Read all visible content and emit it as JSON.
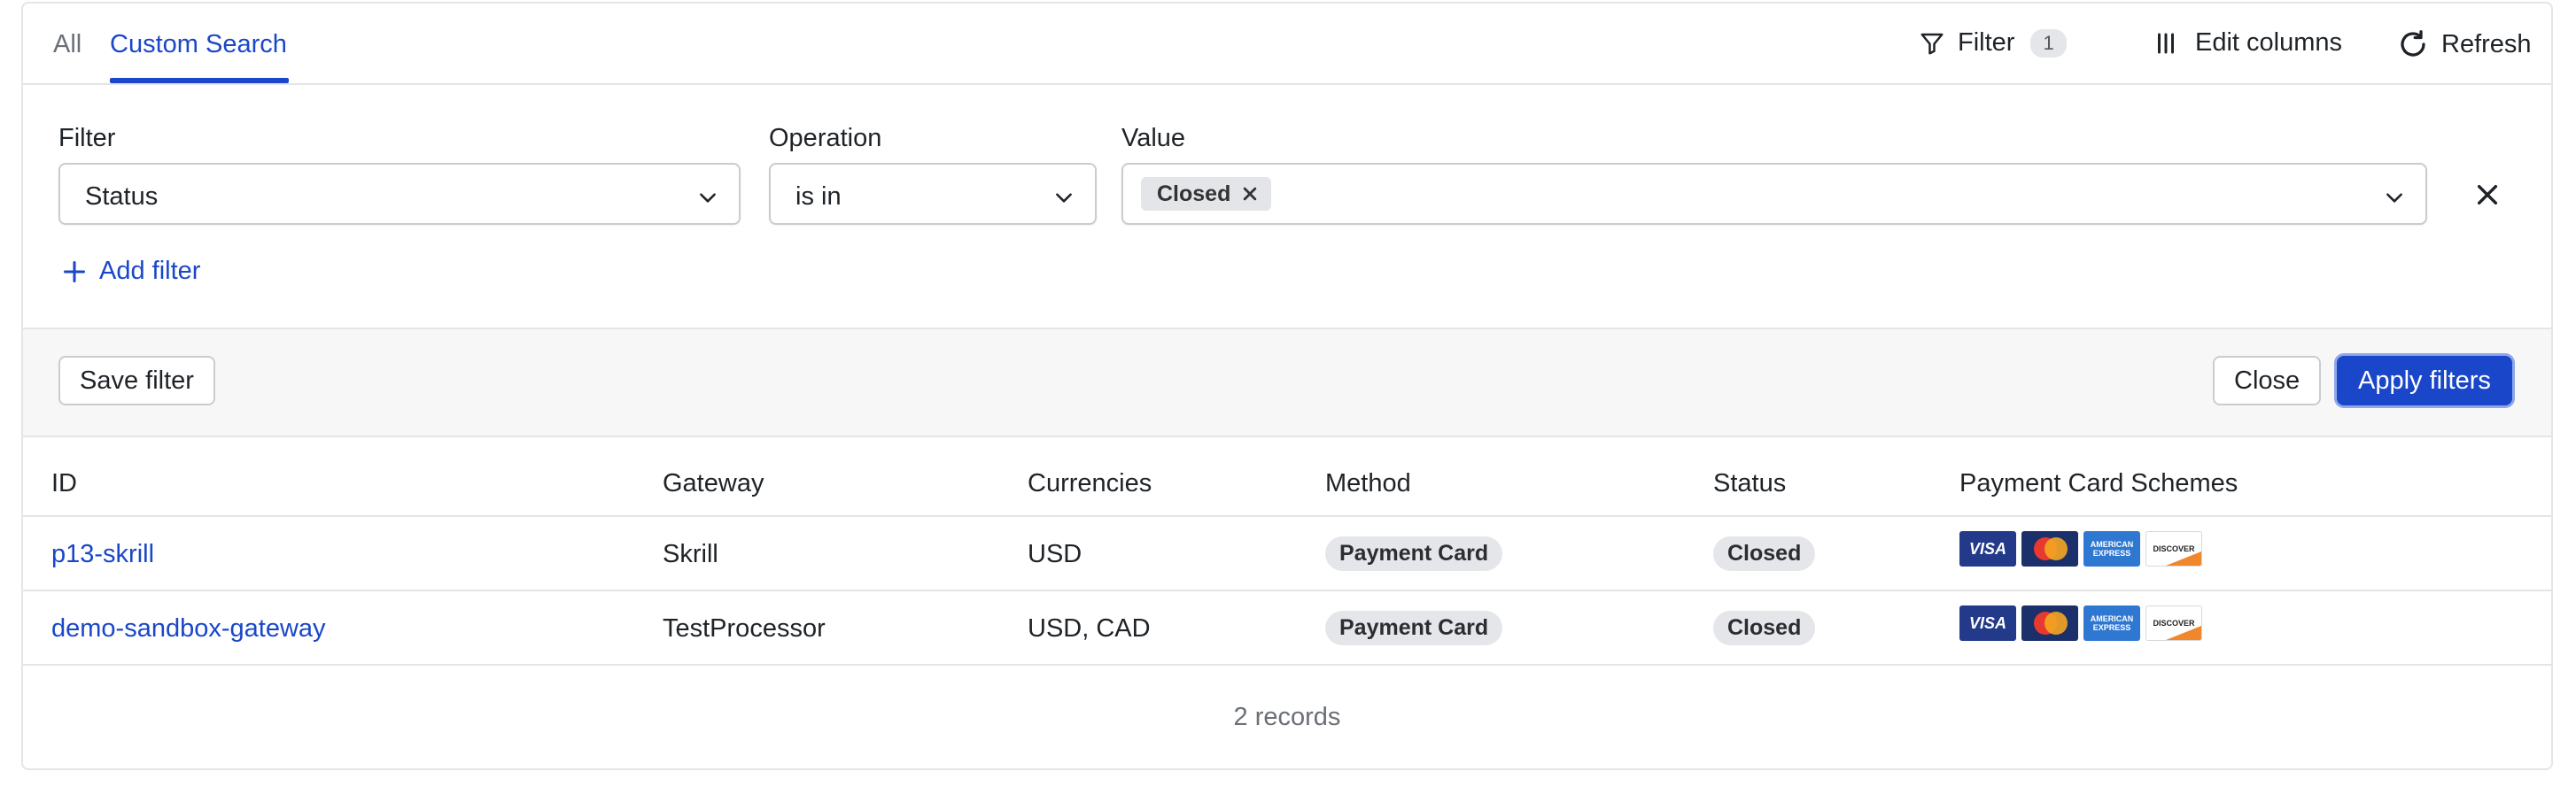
{
  "tabs": [
    {
      "label": "All",
      "active": false
    },
    {
      "label": "Custom Search",
      "active": true
    }
  ],
  "toolbar": {
    "filter_label": "Filter",
    "filter_count": "1",
    "edit_columns_label": "Edit columns",
    "refresh_label": "Refresh"
  },
  "filter_builder": {
    "labels": {
      "filter": "Filter",
      "operation": "Operation",
      "value": "Value"
    },
    "filter_selected": "Status",
    "operation_selected": "is in",
    "value_chips": [
      "Closed"
    ],
    "add_filter_label": "Add filter"
  },
  "actions": {
    "save_filter_label": "Save filter",
    "close_label": "Close",
    "apply_filters_label": "Apply filters"
  },
  "table": {
    "columns": [
      "ID",
      "Gateway",
      "Currencies",
      "Method",
      "Status",
      "Payment Card Schemes"
    ],
    "rows": [
      {
        "id": "p13-skrill",
        "gateway": "Skrill",
        "currencies": "USD",
        "method": "Payment Card",
        "status": "Closed",
        "schemes": [
          "visa-icon",
          "mastercard-icon",
          "amex-icon",
          "discover-icon"
        ]
      },
      {
        "id": "demo-sandbox-gateway",
        "gateway": "TestProcessor",
        "currencies": "USD, CAD",
        "method": "Payment Card",
        "status": "Closed",
        "schemes": [
          "visa-icon",
          "mastercard-icon",
          "amex-icon",
          "discover-icon"
        ]
      }
    ],
    "card_logo_text": {
      "visa": "VISA",
      "mastercard": "MasterCard",
      "amex": "AMERICAN EXPRESS",
      "discover": "DISCOVER"
    },
    "footer": "2 records"
  },
  "colors": {
    "accent": "#1a47c9",
    "border": "#e3e5e8",
    "chip": "#e4e6e9"
  }
}
